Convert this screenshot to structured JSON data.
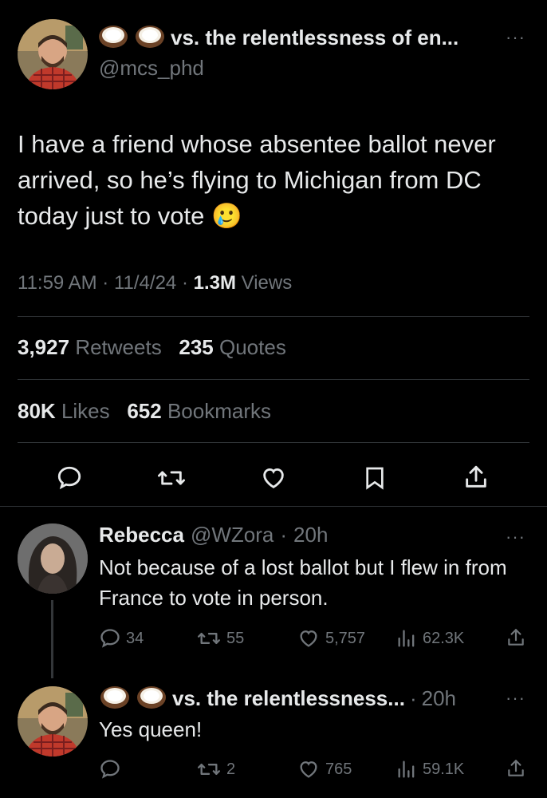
{
  "main_tweet": {
    "display_name": "vs. the relentlessness of en...",
    "handle": "@mcs_phd",
    "text": "I have a friend whose absentee ballot never arrived, so he’s flying to Michigan from DC today just to vote 🥲",
    "time": "11:59 AM",
    "date": "11/4/24",
    "sep": "·",
    "views_count": "1.3M",
    "views_label": "Views",
    "retweets_count": "3,927",
    "retweets_label": "Retweets",
    "quotes_count": "235",
    "quotes_label": "Quotes",
    "likes_count": "80K",
    "likes_label": "Likes",
    "bookmarks_count": "652",
    "bookmarks_label": "Bookmarks",
    "more": "···"
  },
  "reply1": {
    "display_name": "Rebecca",
    "handle": "@WZora",
    "sep": "·",
    "age": "20h",
    "text": "Not because of a lost ballot but I flew in from France to vote in person.",
    "replies": "34",
    "retweets": "55",
    "likes": "5,757",
    "views": "62.3K",
    "more": "···"
  },
  "reply2": {
    "display_name": "vs. the relentlessness...",
    "sep": "·",
    "age": "20h",
    "text": "Yes queen!",
    "retweets": "2",
    "likes": "765",
    "views": "59.1K",
    "more": "···"
  },
  "icons": [
    "coconut-icon",
    "reply-icon",
    "retweet-icon",
    "like-icon",
    "bookmark-icon",
    "share-icon",
    "views-icon",
    "more-icon"
  ],
  "colors": {
    "background": "#000000",
    "text": "#e7e9ea",
    "secondary": "#71767b",
    "divider": "#2f3336"
  }
}
